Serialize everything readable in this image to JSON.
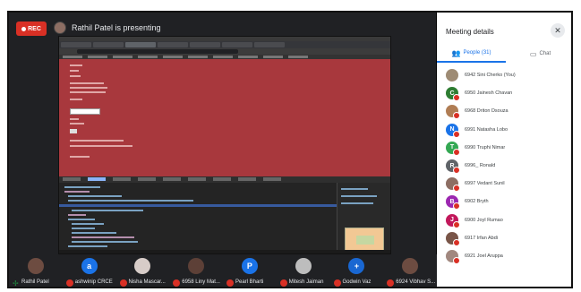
{
  "header": {
    "rec_label": "REC",
    "presenting_text": "Rathil Patel is presenting"
  },
  "sidebar": {
    "title": "Meeting details",
    "close_icon": "close-icon",
    "tabs": [
      {
        "label": "People (31)",
        "icon": "people-icon",
        "active": true
      },
      {
        "label": "Chat",
        "icon": "chat-icon",
        "active": false
      }
    ],
    "people": [
      {
        "name": "6942 Sini Cherko (You)",
        "initial": "",
        "color": "#9e8b74",
        "muted": false
      },
      {
        "name": "6950 Jainesh Chavan",
        "initial": "C",
        "color": "#2e7d32",
        "muted": true
      },
      {
        "name": "6968 Driton Dsouza",
        "initial": "",
        "color": "#b07d54",
        "muted": true
      },
      {
        "name": "6991 Natasha Lobo",
        "initial": "N",
        "color": "#1a73e8",
        "muted": true
      },
      {
        "name": "6990 Truphi Nimar",
        "initial": "T",
        "color": "#34a853",
        "muted": true
      },
      {
        "name": "6996_ Ronald",
        "initial": "R",
        "color": "#5f6368",
        "muted": true
      },
      {
        "name": "6997 Vedant Sunil",
        "initial": "",
        "color": "#8d6e63",
        "muted": true
      },
      {
        "name": "6902 Bryth",
        "initial": "B",
        "color": "#9c27b0",
        "muted": true
      },
      {
        "name": "6900 Joyl Rumao",
        "initial": "J",
        "color": "#c2185b",
        "muted": true
      },
      {
        "name": "6917 Irfan Abdi",
        "initial": "",
        "color": "#795548",
        "muted": true
      },
      {
        "name": "6921 Joel Aruppa",
        "initial": "",
        "color": "#a1887f",
        "muted": true
      }
    ]
  },
  "participants": [
    {
      "label": "Rathil Patel",
      "initial": "",
      "color": "#6d4c41",
      "pin": true
    },
    {
      "label": "ashwinip CRCE",
      "initial": "a",
      "color": "#1a73e8",
      "pin": false
    },
    {
      "label": "Nisha Mascar...",
      "initial": "",
      "color": "#d7ccc8",
      "pin": false
    },
    {
      "label": "6958 Liny Mat...",
      "initial": "",
      "color": "#5d4037",
      "pin": false
    },
    {
      "label": "Pearl Bharti",
      "initial": "P",
      "color": "#1a73e8",
      "pin": false
    },
    {
      "label": "Mitesh Jaiman",
      "initial": "",
      "color": "#bdbdbd",
      "pin": false
    },
    {
      "label": "Godwin Vaz",
      "initial": "+",
      "color": "#1967d2",
      "pin": false
    },
    {
      "label": "6924 Vibhav S...",
      "initial": "",
      "color": "#6d4c41",
      "pin": false
    }
  ],
  "colors": {
    "accent": "#1a73e8",
    "rec": "#d93025",
    "muted_badge": "#d93025",
    "shared_page_bg": "#a8383d"
  }
}
